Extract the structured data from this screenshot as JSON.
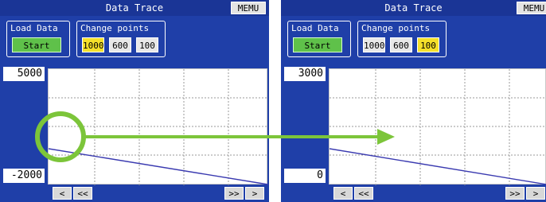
{
  "screens": [
    {
      "title": "Data Trace",
      "menu_label": "MEMU",
      "load_group": {
        "label": "Load Data",
        "start_label": "Start"
      },
      "points_group": {
        "label": "Change points",
        "options": [
          {
            "label": "1000",
            "selected": true
          },
          {
            "label": "600",
            "selected": false
          },
          {
            "label": "100",
            "selected": false
          }
        ]
      },
      "y_max_label": "5000",
      "y_min_label": "-2000",
      "nav": {
        "prev": "<",
        "prev_fast": "<<",
        "next_fast": ">>",
        "next": ">"
      }
    },
    {
      "title": "Data Trace",
      "menu_label": "MEMU",
      "load_group": {
        "label": "Load Data",
        "start_label": "Start"
      },
      "points_group": {
        "label": "Change points",
        "options": [
          {
            "label": "1000",
            "selected": false
          },
          {
            "label": "600",
            "selected": false
          },
          {
            "label": "100",
            "selected": true
          }
        ]
      },
      "y_max_label": "3000",
      "y_min_label": "0",
      "nav": {
        "prev": "<",
        "prev_fast": "<<",
        "next_fast": ">>",
        "next": ">"
      }
    }
  ],
  "colors": {
    "panel_bg": "#1f3fa8",
    "start_button": "#5fc14a",
    "selected_option": "#f5e02a",
    "trace_line": "#3a3ab0",
    "highlight": "#7cc53a"
  }
}
